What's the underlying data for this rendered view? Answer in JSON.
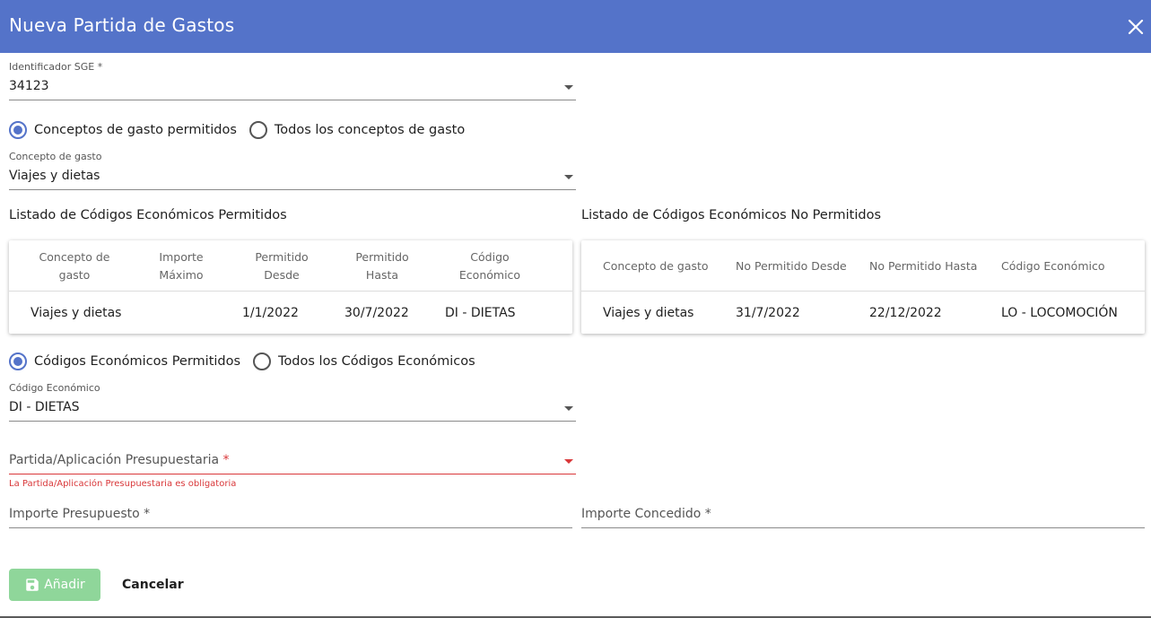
{
  "header": {
    "title": "Nueva Partida de Gastos",
    "accent_color": "#5473c9",
    "close_icon": "close-icon"
  },
  "sge": {
    "label": "Identificador SGE *",
    "value": "34123"
  },
  "concepto_radios": [
    {
      "label": "Conceptos de gasto permitidos",
      "checked": true
    },
    {
      "label": "Todos los conceptos de gasto",
      "checked": false
    }
  ],
  "concepto": {
    "label": "Concepto de gasto",
    "value": "Viajes y dietas"
  },
  "permitidos": {
    "title": "Listado de Códigos Económicos Permitidos",
    "headers": [
      "Concepto de\ngasto",
      "Importe\nMáximo",
      "Permitido\nDesde",
      "Permitido\nHasta",
      "Código\nEconómico"
    ],
    "rows": [
      [
        "Viajes y dietas",
        "",
        "1/1/2022",
        "30/7/2022",
        "DI - DIETAS"
      ]
    ]
  },
  "no_permitidos": {
    "title": "Listado de Códigos Económicos No Permitidos",
    "headers": [
      "Concepto de gasto",
      "No Permitido Desde",
      "No Permitido Hasta",
      "Código Económico"
    ],
    "rows": [
      [
        "Viajes y dietas",
        "31/7/2022",
        "22/12/2022",
        "LO - LOCOMOCIÓN"
      ]
    ]
  },
  "codigo_radios": [
    {
      "label": "Códigos Económicos Permitidos",
      "checked": true
    },
    {
      "label": "Todos los Códigos Económicos",
      "checked": false
    }
  ],
  "codigo": {
    "label": "Código Económico",
    "value": "DI - DIETAS"
  },
  "partida": {
    "placeholder": "Partida/Aplicación Presupuestaria",
    "required_mark": "*",
    "error": "La Partida/Aplicación Presupuestaria es obligatoria",
    "error_color": "#d9383a"
  },
  "importe_presupuesto": {
    "placeholder": "Importe Presupuesto *"
  },
  "importe_concedido": {
    "placeholder": "Importe Concedido *"
  },
  "actions": {
    "add_label": "Añadir",
    "add_icon": "save-icon",
    "add_color": "#8fd69a",
    "cancel_label": "Cancelar"
  }
}
